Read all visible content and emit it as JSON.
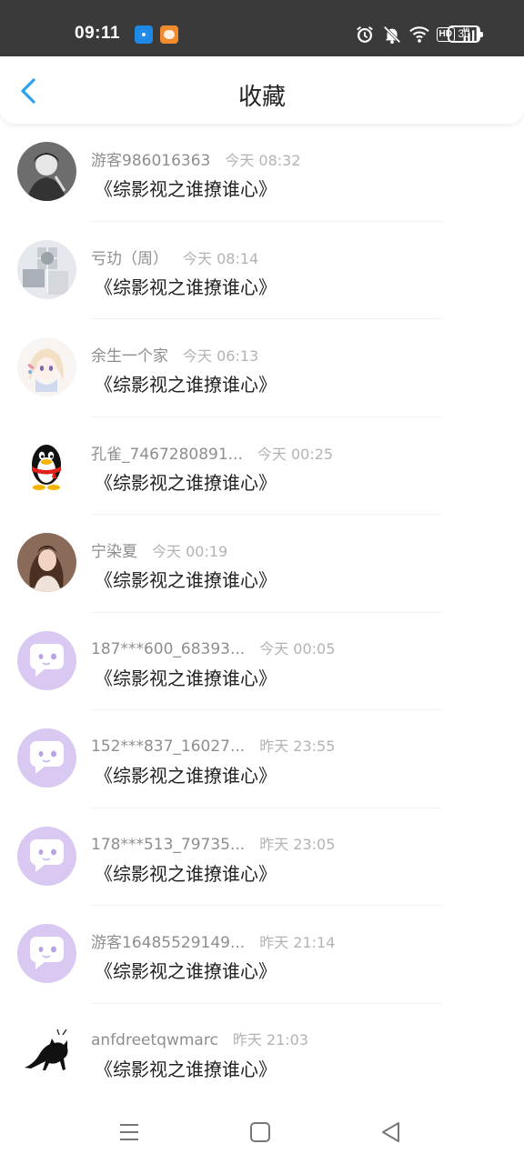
{
  "status_bar": {
    "time": "09:11",
    "hd_label": "HD",
    "network_label": "4G",
    "battery_level": "30",
    "icons": [
      "app-blue-icon",
      "app-orange-icon",
      "alarm-icon",
      "bell-muted-icon",
      "wifi-icon",
      "hd-icon",
      "signal-icon",
      "battery-icon"
    ]
  },
  "header": {
    "title": "收藏",
    "back_icon": "chevron-left-icon",
    "accent": "#2aa4e8"
  },
  "list": {
    "items": [
      {
        "user": "游客986016363",
        "time": "今天 08:32",
        "title": "《综影视之谁撩谁心》",
        "avatar": "photo-avatar-bw"
      },
      {
        "user": "亏玏（周）",
        "time": "今天 08:14",
        "title": "《综影视之谁撩谁心》",
        "avatar": "photo-avatar-grid"
      },
      {
        "user": "余生一个家",
        "time": "今天 06:13",
        "title": "《综影视之谁撩谁心》",
        "avatar": "anime-girl-avatar"
      },
      {
        "user": "孔雀_7467280891...",
        "time": "今天 00:25",
        "title": "《综影视之谁撩谁心》",
        "avatar": "penguin-avatar"
      },
      {
        "user": "宁染夏",
        "time": "今天 00:19",
        "title": "《综影视之谁撩谁心》",
        "avatar": "photo-avatar-portrait"
      },
      {
        "user": "187***600_68393...",
        "time": "今天 00:05",
        "title": "《综影视之谁撩谁心》",
        "avatar": "default-chat-avatar"
      },
      {
        "user": "152***837_16027...",
        "time": "昨天 23:55",
        "title": "《综影视之谁撩谁心》",
        "avatar": "default-chat-avatar"
      },
      {
        "user": "178***513_79735...",
        "time": "昨天 23:05",
        "title": "《综影视之谁撩谁心》",
        "avatar": "default-chat-avatar"
      },
      {
        "user": "游客16485529149...",
        "time": "昨天 21:14",
        "title": "《综影视之谁撩谁心》",
        "avatar": "default-chat-avatar"
      },
      {
        "user": "anfdreetqwmarc",
        "time": "昨天 21:03",
        "title": "《综影视之谁撩谁心》",
        "avatar": "cat-silhouette-avatar"
      }
    ]
  },
  "system_nav": {
    "icons": [
      "menu-icon",
      "home-square-icon",
      "back-triangle-icon"
    ]
  },
  "colors": {
    "status_bar_bg": "#3a3a3a",
    "default_avatar": "#d8c8f2",
    "username": "#8e8e8e",
    "time": "#b3b3b3"
  }
}
